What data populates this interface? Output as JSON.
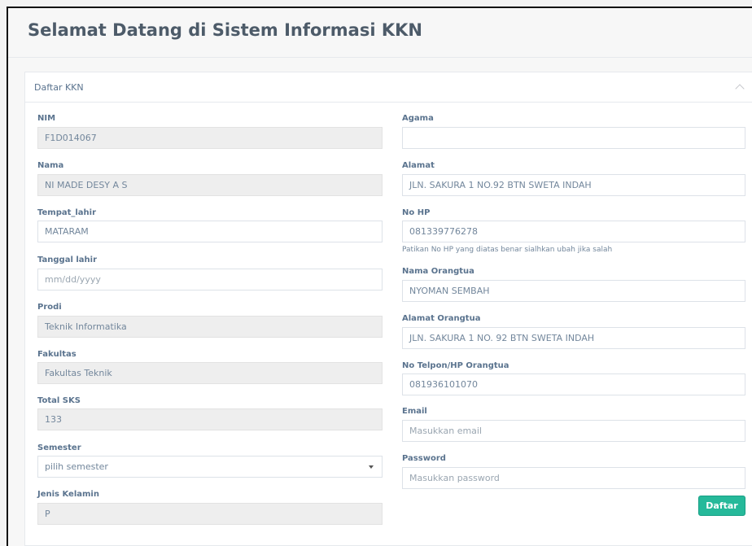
{
  "page": {
    "title": "Selamat Datang di Sistem Informasi KKN"
  },
  "panel": {
    "title": "Daftar KKN",
    "collapse_icon": "chevron-up-icon"
  },
  "left": {
    "nim": {
      "label": "NIM",
      "value": "F1D014067"
    },
    "nama": {
      "label": "Nama",
      "value": "NI MADE DESY A S"
    },
    "tempat_lahir": {
      "label": "Tempat_lahir",
      "value": "MATARAM"
    },
    "tanggal_lahir": {
      "label": "Tanggal lahir",
      "placeholder": "mm/dd/yyyy"
    },
    "prodi": {
      "label": "Prodi",
      "value": "Teknik Informatika"
    },
    "fakultas": {
      "label": "Fakultas",
      "value": "Fakultas Teknik"
    },
    "total_sks": {
      "label": "Total SKS",
      "value": "133"
    },
    "semester": {
      "label": "Semester",
      "selected": "pilih semester"
    },
    "jenis_kelamin": {
      "label": "Jenis Kelamin",
      "value": "P"
    }
  },
  "right": {
    "agama": {
      "label": "Agama",
      "value": ""
    },
    "alamat": {
      "label": "Alamat",
      "value": "JLN. SAKURA 1 NO.92 BTN SWETA INDAH"
    },
    "no_hp": {
      "label": "No HP",
      "value": "081339776278",
      "help": "Patikan No HP yang diatas benar sialhkan ubah jika salah"
    },
    "nama_orangtua": {
      "label": "Nama Orangtua",
      "value": "NYOMAN SEMBAH"
    },
    "alamat_orangtua": {
      "label": "Alamat Orangtua",
      "value": "JLN. SAKURA 1 NO. 92 BTN SWETA INDAH"
    },
    "telp_orangtua": {
      "label": "No Telpon/HP Orangtua",
      "value": "081936101070"
    },
    "email": {
      "label": "Email",
      "placeholder": "Masukkan email"
    },
    "password": {
      "label": "Password",
      "placeholder": "Masukkan password"
    }
  },
  "actions": {
    "submit_label": "Daftar"
  },
  "colors": {
    "accent": "#26b99a",
    "label": "#5a738e",
    "readonly_bg": "#eeeeee"
  }
}
